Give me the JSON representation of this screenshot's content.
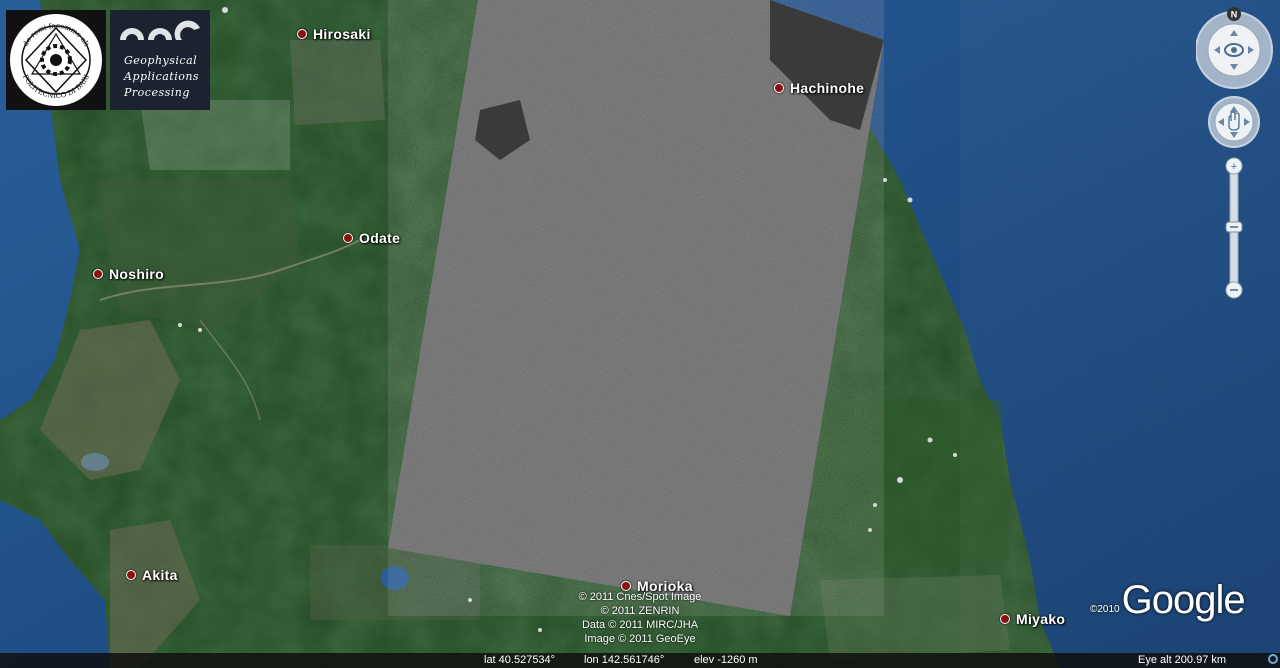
{
  "cities": [
    {
      "name": "Hirosaki"
    },
    {
      "name": "Hachinohe"
    },
    {
      "name": "Odate"
    },
    {
      "name": "Noshiro"
    },
    {
      "name": "Akita"
    },
    {
      "name": "Morioka"
    },
    {
      "name": "Miyako"
    }
  ],
  "logos": {
    "poliba_text": "POLITECNICO DI BARI",
    "poliba_motto": "de remi facemmo ali",
    "gap_words": [
      "Geophysical",
      "Applications",
      "Processing"
    ]
  },
  "attribution": [
    "© 2011 Cnes/Spot Image",
    "© 2011 ZENRIN",
    "Data © 2011 MIRC/JHA",
    "Image © 2011 GeoEye"
  ],
  "brand": {
    "copyright": "©2010",
    "logo": "Google"
  },
  "navigation": {
    "compass_label": "N"
  },
  "status": {
    "lat": "lat  40.527534°",
    "lon": "lon  142.561746°",
    "elev": "elev -1260 m",
    "eye_alt": "Eye alt  200.97 km"
  },
  "colors": {
    "ocean": "#1f4f8c",
    "land": "#254a26",
    "sar_overlay": "#6b6b6b",
    "city_marker": "#8b1010"
  }
}
